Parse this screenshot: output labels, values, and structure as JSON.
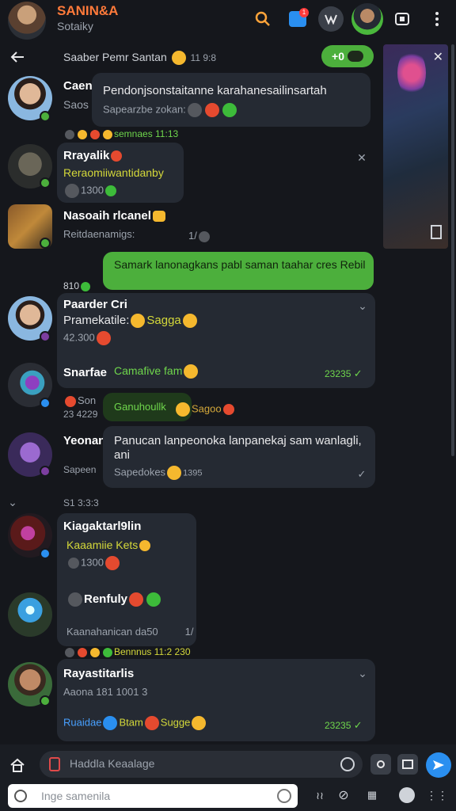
{
  "app": {
    "title": "SANIN&A",
    "subtitle": "Sotaiky",
    "badge_count": "1"
  },
  "chat_header": {
    "title": "Saaber Pemr Santan",
    "meta": "11 9:8",
    "status_pill": "+0"
  },
  "messages": [
    {
      "name": "Caen",
      "sub": "Saos",
      "text": "Pendonjsonstaitanne karahanesailinsartah",
      "meta": "Sapearzbe zokan:",
      "strip": "semnaes 11:13"
    },
    {
      "name": "Rrayalik",
      "text": "Reraomiiwantidanby",
      "meta": "1300"
    },
    {
      "name": "Nasoaih rlcanel",
      "text": "Reitdaenamigs:",
      "meta": "1/"
    },
    {
      "green": "Samark lanonagkans pabl saman taahar cres Rebil",
      "meta_left": "810"
    },
    {
      "name": "Paarder Cri",
      "text": "Pramekatile:",
      "emoji_label": "Sagga",
      "meta": "42.300"
    },
    {
      "name": "Snarfae",
      "text": "Camafive fam",
      "time": "23235"
    },
    {
      "sub": "Son",
      "meta": "23 4229",
      "green": "Ganuhoullk",
      "label": "Sagoo"
    },
    {
      "name": "Yeonan",
      "sub": "Sapeen",
      "text": "Panucan lanpeonoka lanpanekaj sam wanlagli, ani",
      "meta": "Sapedokes",
      "meta2": "1395"
    },
    {
      "divider": "S1 3:3:3"
    },
    {
      "name": "Kiagaktarl9lin",
      "text": "Kaaamiie Kets",
      "meta": "1300"
    },
    {
      "name": "Renfuly",
      "meta": "Kaanahanican da50",
      "meta2": "1/"
    },
    {
      "strip": "Bennnus 11:2 230"
    },
    {
      "name": "Rayastitarlis",
      "text": "Aaona 181 1001",
      "meta": "3",
      "label_blue": "Ruaidae",
      "label": "Btam",
      "label2": "Sugge",
      "time": "23235"
    }
  ],
  "composer": {
    "placeholder_main": "Haddla Keaalage",
    "placeholder_input": "Inge samenila"
  },
  "colors": {
    "accent_green": "#4caf3c",
    "accent_blue": "#2a8ff0",
    "bubble": "#252a33",
    "bg": "#15171c"
  }
}
